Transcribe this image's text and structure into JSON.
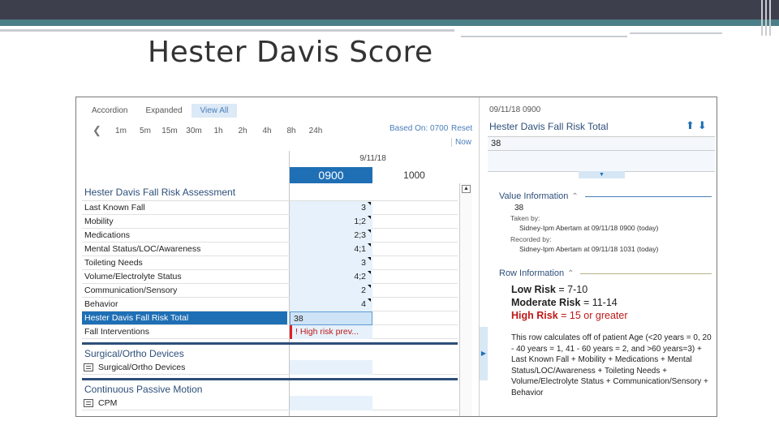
{
  "slide": {
    "title": "Hester Davis Score"
  },
  "toolbar": {
    "view_tabs": [
      "Accordion",
      "Expanded",
      "View All"
    ],
    "active_view": "View All",
    "time_intervals": [
      "1m",
      "5m",
      "15m",
      "30m",
      "1h",
      "2h",
      "4h",
      "8h",
      "24h"
    ],
    "based_on": "Based On: 0700",
    "reset": "Reset",
    "now": "Now"
  },
  "grid": {
    "date": "9/11/18",
    "columns": [
      "0900",
      "1000"
    ],
    "selected_column": "0900",
    "section_title": "Hester Davis Fall Risk Assessment",
    "rows": [
      {
        "label": "Last Known Fall",
        "value": "3"
      },
      {
        "label": "Mobility",
        "value": "1;2"
      },
      {
        "label": "Medications",
        "value": "2;3"
      },
      {
        "label": "Mental Status/LOC/Awareness",
        "value": "4;1"
      },
      {
        "label": "Toileting Needs",
        "value": "3"
      },
      {
        "label": "Volume/Electrolyte Status",
        "value": "4;2"
      },
      {
        "label": "Communication/Sensory",
        "value": "2"
      },
      {
        "label": "Behavior",
        "value": "4"
      }
    ],
    "total_row": {
      "label": "Hester Davis Fall Risk Total",
      "value": "38"
    },
    "interventions_row": {
      "label": "Fall Interventions",
      "value": "! High risk prev..."
    },
    "section2_title": "Surgical/Ortho Devices",
    "section2_item": "Surgical/Ortho Devices",
    "section3_title": "Continuous Passive Motion",
    "section3_item": "CPM"
  },
  "detail": {
    "datetime": "09/11/18 0900",
    "title": "Hester Davis Fall Risk Total",
    "value": "38",
    "value_info_heading": "Value Information",
    "value_info_value": "38",
    "taken_by_label": "Taken by:",
    "taken_by": "Sidney-Ipm Abertam at 09/11/18 0900 (today)",
    "recorded_by_label": "Recorded by:",
    "recorded_by": "Sidney-Ipm Abertam at 09/11/18 1031 (today)",
    "row_info_heading": "Row Information",
    "risk_levels": [
      {
        "name": "Low Risk",
        "range": "= 7-10"
      },
      {
        "name": "Moderate Risk",
        "range": "= 11-14"
      },
      {
        "name": "High Risk",
        "range": "= 15 or greater"
      }
    ],
    "calc_text": "This row calculates off of patient Age (<20 years = 0, 20 - 40 years = 1, 41 - 60 years = 2, and >60 years=3) + Last Known Fall + Mobility + Medications + Mental Status/LOC/Awareness + Toileting Needs + Volume/Electrolyte Status + Communication/Sensory + Behavior"
  },
  "colors": {
    "accent_blue": "#1f6fb5",
    "header_text": "#2d4f7a",
    "high_risk_red": "#c01818",
    "cell_bg": "#e6f1fb"
  }
}
